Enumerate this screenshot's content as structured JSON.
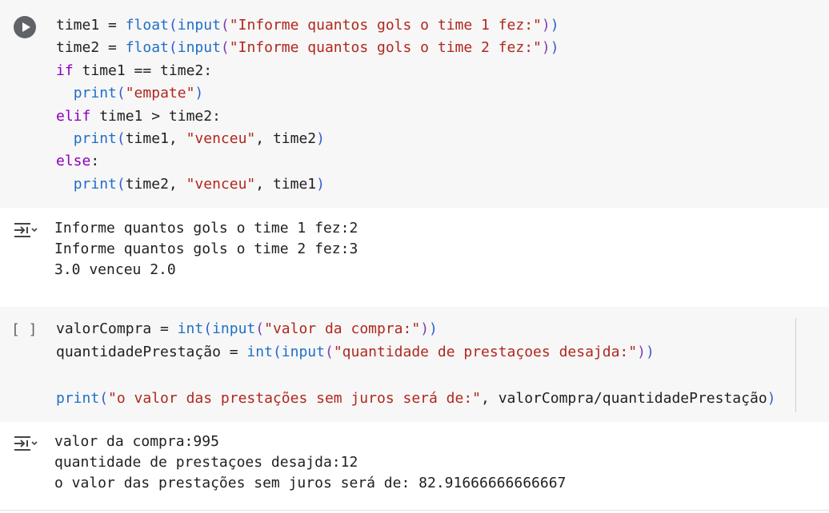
{
  "cell1": {
    "lines": [
      [
        [
          "",
          "time1 = "
        ],
        [
          "fn",
          "float"
        ],
        [
          "p1",
          "("
        ],
        [
          "fn",
          "input"
        ],
        [
          "p2",
          "("
        ],
        [
          "str",
          "\"Informe quantos gols o time 1 fez:\""
        ],
        [
          "p2",
          ")"
        ],
        [
          "p1",
          ")"
        ]
      ],
      [
        [
          "",
          "time2 = "
        ],
        [
          "fn",
          "float"
        ],
        [
          "p1",
          "("
        ],
        [
          "fn",
          "input"
        ],
        [
          "p2",
          "("
        ],
        [
          "str",
          "\"Informe quantos gols o time 2 fez:\""
        ],
        [
          "p2",
          ")"
        ],
        [
          "p1",
          ")"
        ]
      ],
      [
        [
          "kw",
          "if"
        ],
        [
          "",
          " time1 == time2:"
        ]
      ],
      [
        [
          "",
          "  "
        ],
        [
          "fn",
          "print"
        ],
        [
          "p1",
          "("
        ],
        [
          "str",
          "\"empate\""
        ],
        [
          "p1",
          ")"
        ]
      ],
      [
        [
          "kw",
          "elif"
        ],
        [
          "",
          " time1 > time2:"
        ]
      ],
      [
        [
          "",
          "  "
        ],
        [
          "fn",
          "print"
        ],
        [
          "p1",
          "("
        ],
        [
          "",
          "time1, "
        ],
        [
          "str",
          "\"venceu\""
        ],
        [
          "",
          ", time2"
        ],
        [
          "p1",
          ")"
        ]
      ],
      [
        [
          "kw",
          "else"
        ],
        [
          "",
          ":"
        ]
      ],
      [
        [
          "",
          "  "
        ],
        [
          "fn",
          "print"
        ],
        [
          "p1",
          "("
        ],
        [
          "",
          "time2, "
        ],
        [
          "str",
          "\"venceu\""
        ],
        [
          "",
          ", time1"
        ],
        [
          "p1",
          ")"
        ]
      ]
    ],
    "output": [
      "Informe quantos gols o time 1 fez:2",
      "Informe quantos gols o time 2 fez:3",
      "3.0 venceu 2.0"
    ]
  },
  "cell2": {
    "exec_count": "[ ]",
    "lines": [
      [
        [
          "",
          "valorCompra = "
        ],
        [
          "fn",
          "int"
        ],
        [
          "p1",
          "("
        ],
        [
          "fn",
          "input"
        ],
        [
          "p2",
          "("
        ],
        [
          "str",
          "\"valor da compra:\""
        ],
        [
          "p2",
          ")"
        ],
        [
          "p1",
          ")"
        ]
      ],
      [
        [
          "",
          "quantidadePrestação = "
        ],
        [
          "fn",
          "int"
        ],
        [
          "p1",
          "("
        ],
        [
          "fn",
          "input"
        ],
        [
          "p2",
          "("
        ],
        [
          "str",
          "\"quantidade de prestaçoes desajda:\""
        ],
        [
          "p2",
          ")"
        ],
        [
          "p1",
          ")"
        ]
      ],
      [
        [
          "",
          ""
        ]
      ],
      [
        [
          "fn",
          "print"
        ],
        [
          "p1",
          "("
        ],
        [
          "str",
          "\"o valor das prestações sem juros será de:\""
        ],
        [
          "",
          ", valorCompra/quantidadePrestação"
        ],
        [
          "p1",
          ")"
        ]
      ]
    ],
    "output": [
      "valor da compra:995",
      "quantidade de prestaçoes desajda:12",
      "o valor das prestações sem juros será de: 82.91666666666667"
    ]
  },
  "icons": {
    "run": "play-circle-icon",
    "output": "output-toggle-icon"
  },
  "colors": {
    "keyword": "#8b00b9",
    "function": "#1f6fc8",
    "string": "#b0271d",
    "code_bg": "#f7f7f7"
  }
}
